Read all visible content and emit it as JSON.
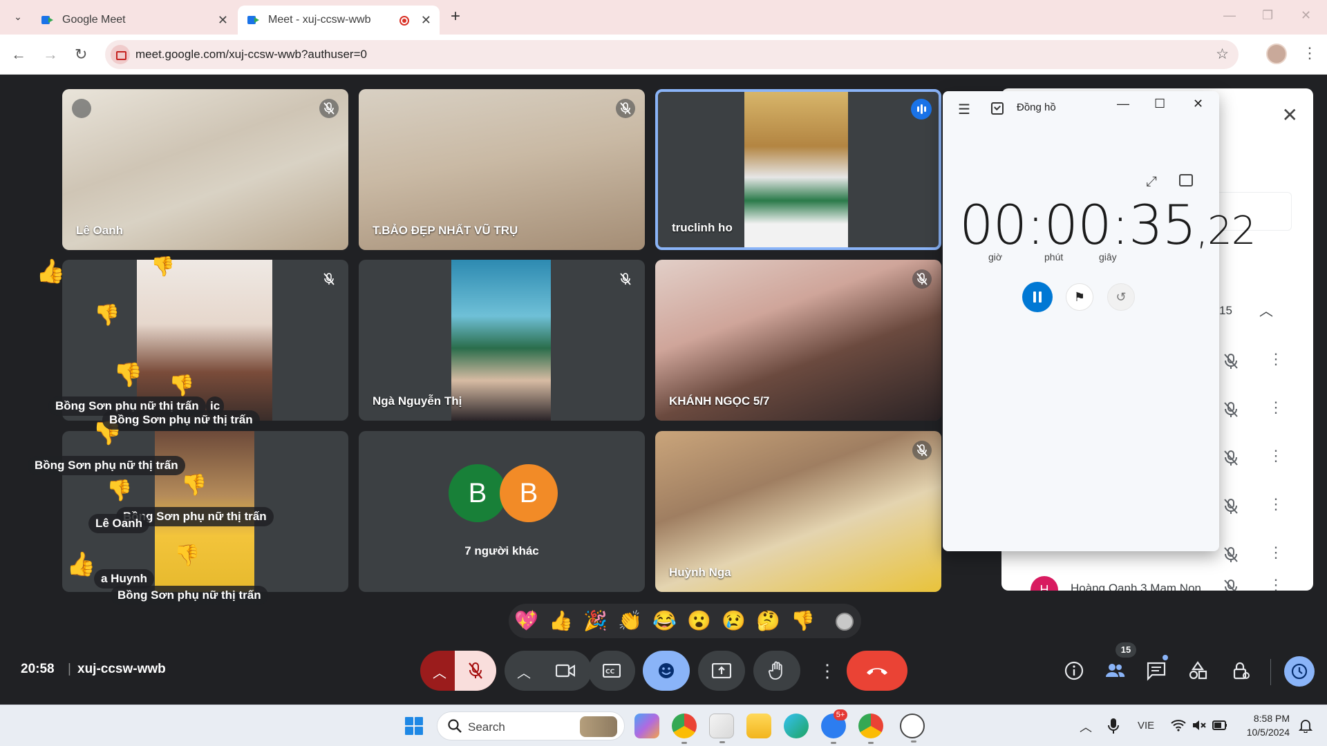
{
  "browser": {
    "tabs": [
      {
        "title": "Google Meet",
        "active": false
      },
      {
        "title": "Meet - xuj-ccsw-wwb",
        "active": true,
        "recording": true
      }
    ],
    "url": "meet.google.com/xuj-ccsw-wwb?authuser=0"
  },
  "tiles": [
    {
      "name": "Lê Oanh",
      "muted": true
    },
    {
      "name": "T.BẢO ĐẸP NHẤT VŨ TRỤ",
      "muted": true
    },
    {
      "name": "truclinh ho",
      "muted": false,
      "speaking": true
    },
    {
      "name": "",
      "muted": true
    },
    {
      "name": "Ngà Nguyễn Thị",
      "muted": true
    },
    {
      "name": "KHÁNH NGỌC 5/7",
      "muted": true
    },
    {
      "name": "",
      "muted": false
    },
    {
      "name": "7 người khác",
      "avatars": [
        "B",
        "B"
      ],
      "avatar_colors": [
        "#188038",
        "#f28b27"
      ]
    },
    {
      "name": "Huỳnh Nga",
      "muted": true
    }
  ],
  "reaction_overlays": {
    "labels": [
      "Bồng Sơn phụ nữ thị trấn",
      "Bồng Sơn phụ nữ thị trấn",
      "Bồng Sơn phụ nữ thị trấn",
      "Bồng Sơn phụ nữ thị trấn",
      "Lê Oanh",
      "a Huynh",
      "Bồng Sơn phụ nữ thị trấn"
    ],
    "partial_text": "ic"
  },
  "participants_panel": {
    "count": "15",
    "last_row": {
      "initial": "H",
      "name": "Hoàng Oanh 3 Mam Non"
    }
  },
  "clock_app": {
    "title": "Đồng hồ",
    "time_main": "00:00:35",
    "time_cs": ",22",
    "units": [
      "giờ",
      "phút",
      "giây"
    ]
  },
  "reactions_bar": [
    "💖",
    "👍",
    "🎉",
    "👏",
    "😂",
    "😮",
    "😢",
    "🤔",
    "👎"
  ],
  "meeting": {
    "time": "20:58",
    "code": "xuj-ccsw-wwb",
    "people_badge": "15"
  },
  "taskbar": {
    "search_placeholder": "Search",
    "language": "VIE",
    "time": "8:58 PM",
    "date": "10/5/2024",
    "zalo_badge": "5+"
  },
  "colors": {
    "meet_bg": "#202124",
    "tile_bg": "#3c4043",
    "end_call": "#ea4335",
    "accent_blue": "#8ab4f8",
    "clock_accent": "#0078d4"
  }
}
